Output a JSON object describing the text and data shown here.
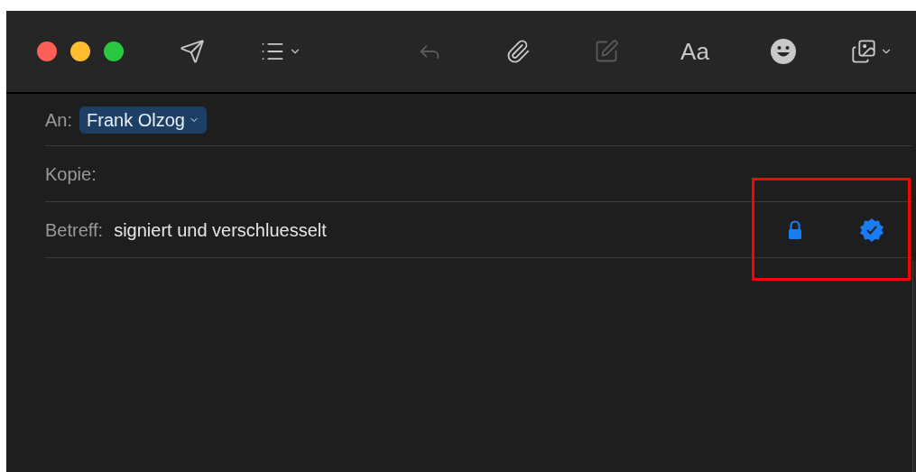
{
  "toolbar": {
    "buttons": [
      {
        "kind": "send",
        "disabled": false,
        "menu": false
      },
      {
        "kind": "list",
        "disabled": false,
        "menu": true
      },
      {
        "kind": "reply",
        "disabled": true,
        "menu": false
      },
      {
        "kind": "attach",
        "disabled": false,
        "menu": false
      },
      {
        "kind": "markup",
        "disabled": true,
        "menu": false
      },
      {
        "kind": "format",
        "label": "Aa",
        "disabled": false,
        "menu": false
      },
      {
        "kind": "emoji",
        "disabled": false,
        "menu": false
      },
      {
        "kind": "photo",
        "disabled": false,
        "menu": true
      }
    ]
  },
  "header": {
    "to": {
      "label": "An:",
      "recipients": [
        "Frank Olzog"
      ]
    },
    "cc": {
      "label": "Kopie:"
    },
    "subject": {
      "label": "Betreff:",
      "value": "signiert und verschluesselt",
      "encrypted": true,
      "signed": true
    }
  }
}
